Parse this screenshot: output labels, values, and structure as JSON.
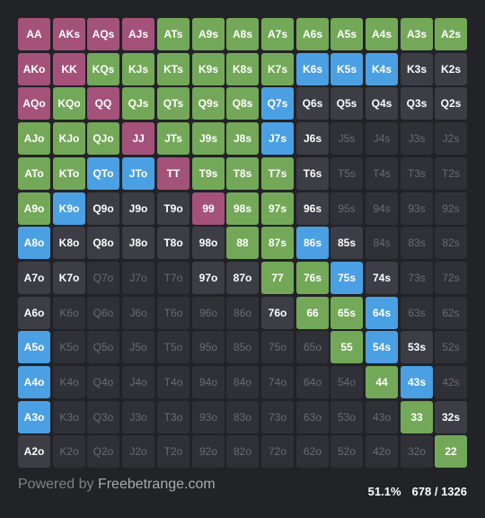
{
  "colors": {
    "purple": "#a4527a",
    "green": "#73a858",
    "blue": "#4b9fe3",
    "dark": "#3c3d45",
    "empty": "#303137"
  },
  "grid": {
    "rows": [
      [
        "AA",
        "AKs",
        "AQs",
        "AJs",
        "ATs",
        "A9s",
        "A8s",
        "A7s",
        "A6s",
        "A5s",
        "A4s",
        "A3s",
        "A2s"
      ],
      [
        "AKo",
        "KK",
        "KQs",
        "KJs",
        "KTs",
        "K9s",
        "K8s",
        "K7s",
        "K6s",
        "K5s",
        "K4s",
        "K3s",
        "K2s"
      ],
      [
        "AQo",
        "KQo",
        "QQ",
        "QJs",
        "QTs",
        "Q9s",
        "Q8s",
        "Q7s",
        "Q6s",
        "Q5s",
        "Q4s",
        "Q3s",
        "Q2s"
      ],
      [
        "AJo",
        "KJo",
        "QJo",
        "JJ",
        "JTs",
        "J9s",
        "J8s",
        "J7s",
        "J6s",
        "J5s",
        "J4s",
        "J3s",
        "J2s"
      ],
      [
        "ATo",
        "KTo",
        "QTo",
        "JTo",
        "TT",
        "T9s",
        "T8s",
        "T7s",
        "T6s",
        "T5s",
        "T4s",
        "T3s",
        "T2s"
      ],
      [
        "A9o",
        "K9o",
        "Q9o",
        "J9o",
        "T9o",
        "99",
        "98s",
        "97s",
        "96s",
        "95s",
        "94s",
        "93s",
        "92s"
      ],
      [
        "A8o",
        "K8o",
        "Q8o",
        "J8o",
        "T8o",
        "98o",
        "88",
        "87s",
        "86s",
        "85s",
        "84s",
        "83s",
        "82s"
      ],
      [
        "A7o",
        "K7o",
        "Q7o",
        "J7o",
        "T7o",
        "97o",
        "87o",
        "77",
        "76s",
        "75s",
        "74s",
        "73s",
        "72s"
      ],
      [
        "A6o",
        "K6o",
        "Q6o",
        "J6o",
        "T6o",
        "96o",
        "86o",
        "76o",
        "66",
        "65s",
        "64s",
        "63s",
        "62s"
      ],
      [
        "A5o",
        "K5o",
        "Q5o",
        "J5o",
        "T5o",
        "95o",
        "85o",
        "75o",
        "65o",
        "55",
        "54s",
        "53s",
        "52s"
      ],
      [
        "A4o",
        "K4o",
        "Q4o",
        "J4o",
        "T4o",
        "94o",
        "84o",
        "74o",
        "64o",
        "54o",
        "44",
        "43s",
        "42s"
      ],
      [
        "A3o",
        "K3o",
        "Q3o",
        "J3o",
        "T3o",
        "93o",
        "83o",
        "73o",
        "63o",
        "53o",
        "43o",
        "33",
        "32s"
      ],
      [
        "A2o",
        "K2o",
        "Q2o",
        "J2o",
        "T2o",
        "92o",
        "82o",
        "72o",
        "62o",
        "52o",
        "42o",
        "32o",
        "22"
      ]
    ],
    "states": [
      [
        "P",
        "P",
        "P",
        "P",
        "G",
        "G",
        "G",
        "G",
        "G",
        "G",
        "G",
        "G",
        "G"
      ],
      [
        "P",
        "P",
        "G",
        "G",
        "G",
        "G",
        "G",
        "G",
        "B",
        "B",
        "B",
        "D",
        "D"
      ],
      [
        "P",
        "G",
        "P",
        "G",
        "G",
        "G",
        "G",
        "B",
        "D",
        "D",
        "D",
        "D",
        "D"
      ],
      [
        "G",
        "G",
        "G",
        "P",
        "G",
        "G",
        "G",
        "B",
        "D",
        "E",
        "E",
        "E",
        "E"
      ],
      [
        "G",
        "G",
        "B",
        "B",
        "P",
        "G",
        "G",
        "G",
        "D",
        "E",
        "E",
        "E",
        "E"
      ],
      [
        "G",
        "B",
        "D",
        "D",
        "D",
        "P",
        "G",
        "G",
        "D",
        "E",
        "E",
        "E",
        "E"
      ],
      [
        "B",
        "D",
        "D",
        "D",
        "D",
        "D",
        "G",
        "G",
        "B",
        "D",
        "E",
        "E",
        "E"
      ],
      [
        "D",
        "D",
        "E",
        "E",
        "E",
        "D",
        "D",
        "G",
        "G",
        "B",
        "D",
        "E",
        "E"
      ],
      [
        "D",
        "E",
        "E",
        "E",
        "E",
        "E",
        "E",
        "D",
        "G",
        "G",
        "B",
        "E",
        "E"
      ],
      [
        "B",
        "E",
        "E",
        "E",
        "E",
        "E",
        "E",
        "E",
        "E",
        "G",
        "B",
        "D",
        "E"
      ],
      [
        "B",
        "E",
        "E",
        "E",
        "E",
        "E",
        "E",
        "E",
        "E",
        "E",
        "G",
        "B",
        "E"
      ],
      [
        "B",
        "E",
        "E",
        "E",
        "E",
        "E",
        "E",
        "E",
        "E",
        "E",
        "E",
        "G",
        "D"
      ],
      [
        "D",
        "E",
        "E",
        "E",
        "E",
        "E",
        "E",
        "E",
        "E",
        "E",
        "E",
        "E",
        "G"
      ]
    ]
  },
  "footer": {
    "powered_prefix": "Powered by",
    "brand": "Freebetrange.com",
    "percent": "51.1%",
    "combos": "678 / 1326"
  }
}
